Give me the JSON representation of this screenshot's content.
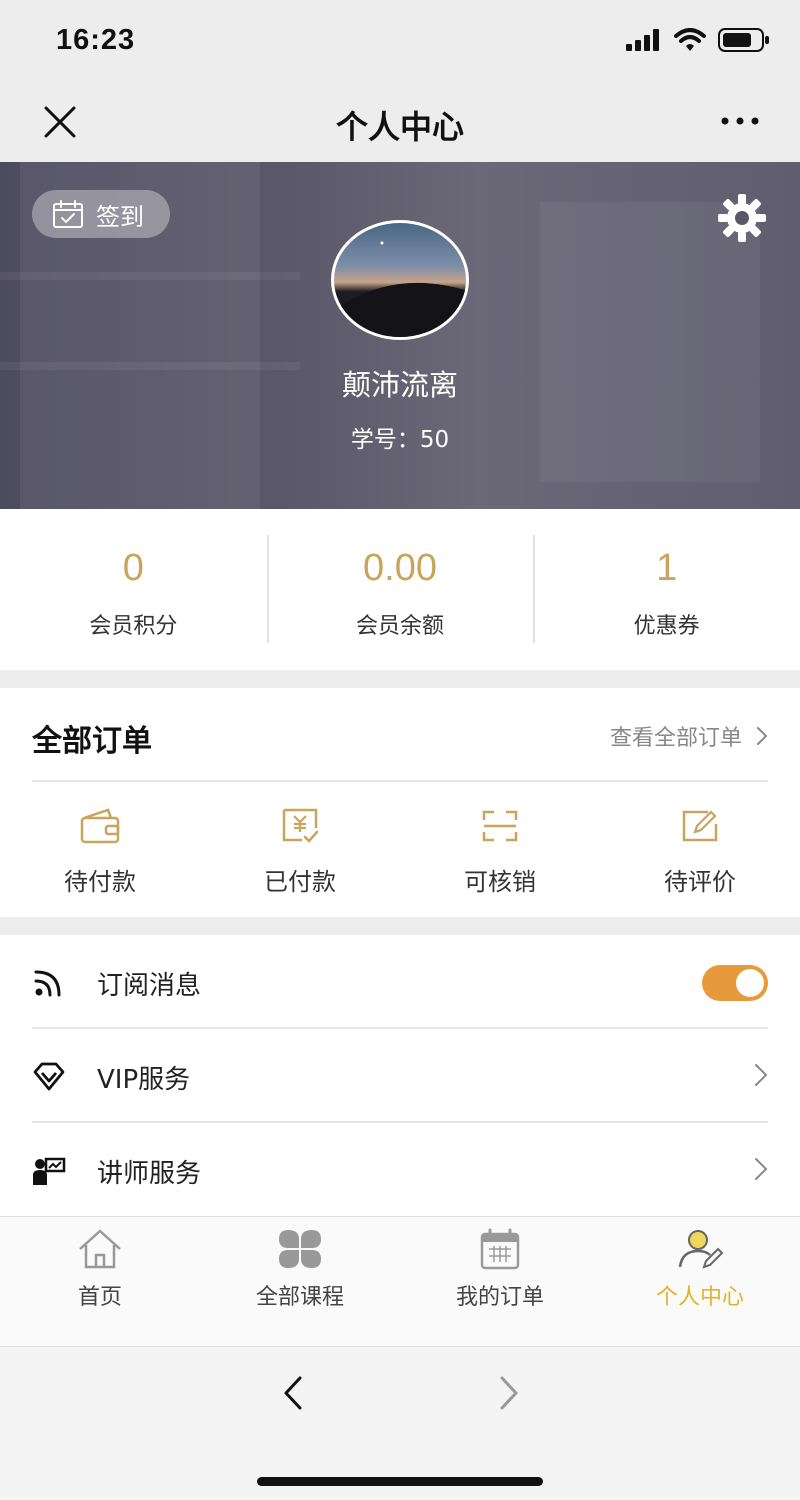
{
  "status_bar": {
    "time": "16:23"
  },
  "nav": {
    "title": "个人中心"
  },
  "profile": {
    "checkin_label": "签到",
    "username": "颠沛流离",
    "student_id": "学号：50"
  },
  "stats": [
    {
      "value": "0",
      "label": "会员积分"
    },
    {
      "value": "0.00",
      "label": "会员余额"
    },
    {
      "value": "1",
      "label": "优惠券"
    }
  ],
  "orders": {
    "title": "全部订单",
    "view_all": "查看全部订单",
    "items": [
      {
        "label": "待付款",
        "icon": "wallet-icon"
      },
      {
        "label": "已付款",
        "icon": "paid-receipt-icon"
      },
      {
        "label": "可核销",
        "icon": "scan-icon"
      },
      {
        "label": "待评价",
        "icon": "edit-review-icon"
      }
    ]
  },
  "menu": [
    {
      "label": "订阅消息",
      "icon": "rss-icon",
      "toggle_on": true
    },
    {
      "label": "VIP服务",
      "icon": "diamond-icon"
    },
    {
      "label": "讲师服务",
      "icon": "lecturer-icon"
    }
  ],
  "tabs": [
    {
      "label": "首页",
      "icon": "home-icon",
      "active": false
    },
    {
      "label": "全部课程",
      "icon": "clover-icon",
      "active": false
    },
    {
      "label": "我的订单",
      "icon": "calendar-icon",
      "active": false
    },
    {
      "label": "个人中心",
      "icon": "user-edit-icon",
      "active": true
    }
  ],
  "colors": {
    "accent_gold": "#c9a45c",
    "toggle_orange": "#e69a3c",
    "tab_active": "#e1b428"
  }
}
